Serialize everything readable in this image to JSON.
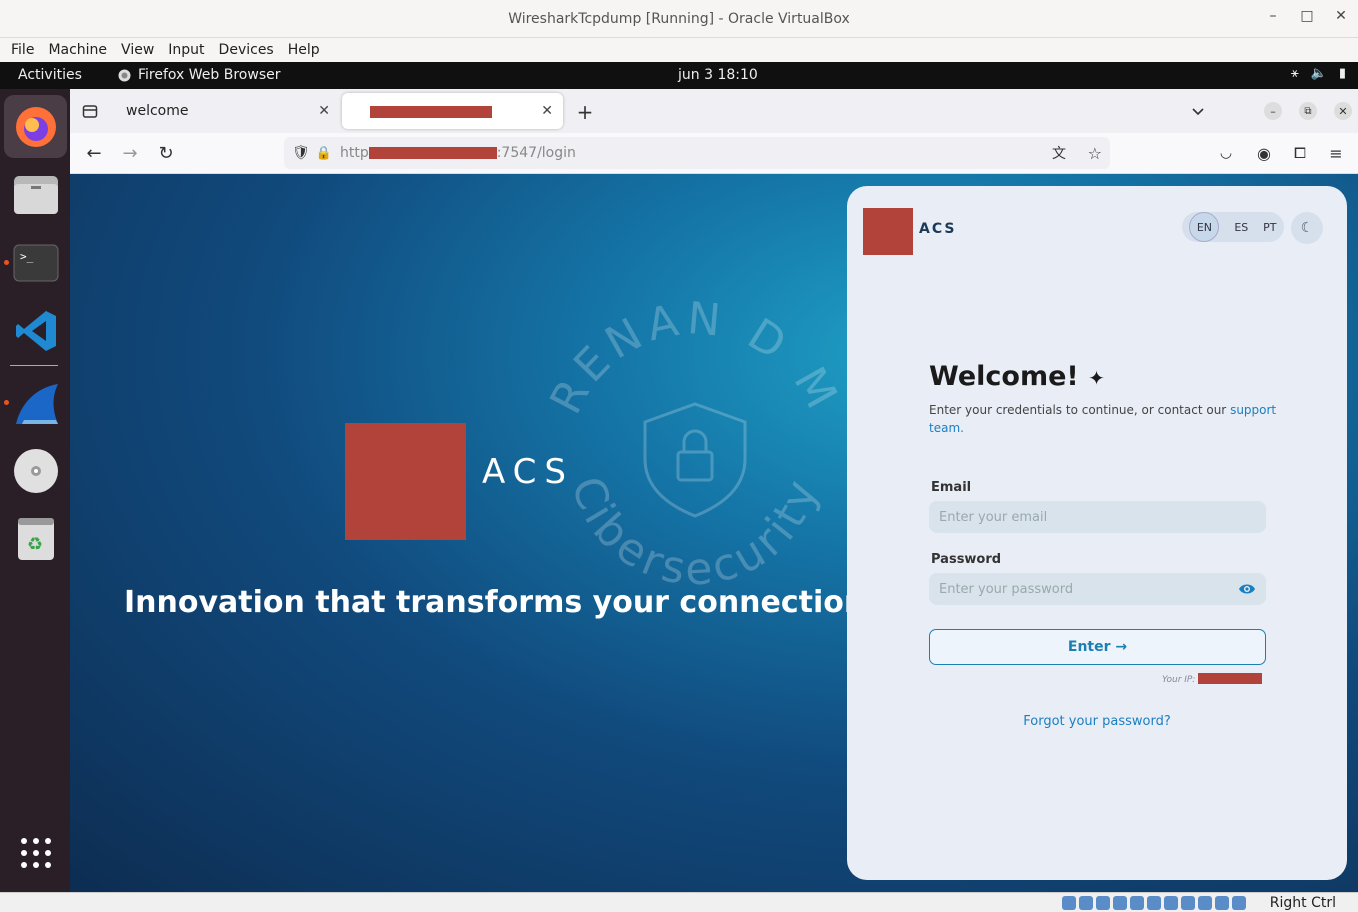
{
  "vbox": {
    "title": "WiresharkTcpdump [Running] - Oracle VirtualBox",
    "controls": [
      "–",
      "□",
      "✕"
    ],
    "menu": [
      "File",
      "Machine",
      "View",
      "Input",
      "Devices",
      "Help"
    ],
    "status_key": "Right Ctrl"
  },
  "gnome": {
    "activities": "Activities",
    "app_name": "Firefox Web Browser",
    "clock": "jun 3  18:10"
  },
  "dock": {
    "items": [
      "firefox-icon",
      "files-icon",
      "terminal-icon",
      "vscode-icon",
      "wireshark-icon",
      "disc-icon",
      "trash-icon",
      "app-grid-icon"
    ]
  },
  "browser": {
    "tabs": [
      {
        "label": "welcome"
      },
      {
        "label": ""
      }
    ],
    "url_prefix": "http",
    "url_suffix": ":7547/login"
  },
  "hero": {
    "brand": "ACS",
    "tagline": "Innovation that transforms your connection.",
    "watermark_top": "RENAN D M",
    "watermark_bottom": "Cibersecurity"
  },
  "login": {
    "brand": "ACS",
    "languages": [
      "EN",
      "ES",
      "PT"
    ],
    "active_language": "EN",
    "title": "Welcome!",
    "subtitle": "Enter your credentials to continue, or contact our",
    "support_link": "support team.",
    "email_label": "Email",
    "email_placeholder": "Enter your email",
    "password_label": "Password",
    "password_placeholder": "Enter your password",
    "enter_button": "Enter",
    "ip_label": "Your IP:",
    "forgot": "Forgot your password?"
  },
  "colors": {
    "brand_red": "#b2433a",
    "accent_blue": "#1a7fc1"
  }
}
